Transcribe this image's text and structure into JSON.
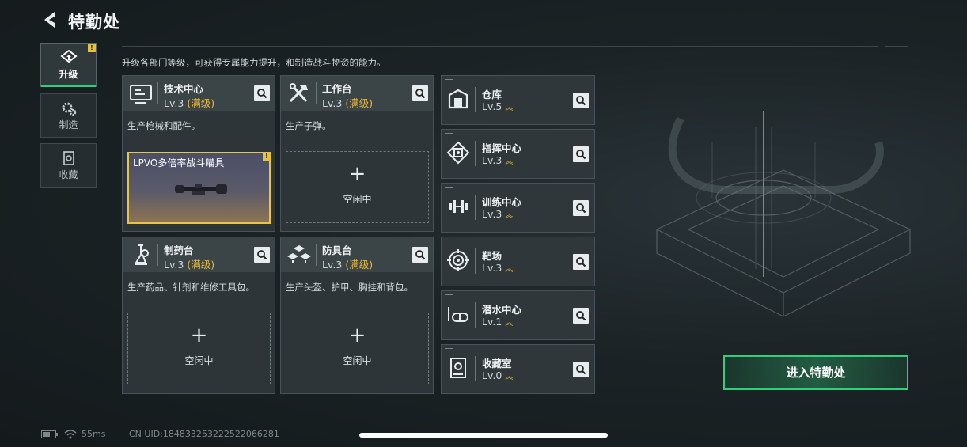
{
  "header": {
    "title": "特勤处",
    "description": "升级各部门等级，可获得专属能力提升，和制造战斗物资的能力。"
  },
  "sidebar": {
    "tabs": [
      {
        "label": "升级",
        "icon": "upgrade-icon",
        "active": true,
        "badge": "!"
      },
      {
        "label": "制造",
        "icon": "gears-icon",
        "active": false
      },
      {
        "label": "收藏",
        "icon": "collection-icon",
        "active": false
      }
    ]
  },
  "workshops": [
    {
      "name": "技术中心",
      "level": "Lv.3",
      "max": "(满级)",
      "desc": "生产枪械和配件。",
      "icon": "tech-center-icon",
      "slot": {
        "state": "producing",
        "item": "LPVO多倍率战斗瞄具",
        "badge": "!"
      }
    },
    {
      "name": "工作台",
      "level": "Lv.3",
      "max": "(满级)",
      "desc": "生产子弹。",
      "icon": "workbench-icon",
      "slot": {
        "state": "idle",
        "label": "空闲中"
      }
    },
    {
      "name": "制药台",
      "level": "Lv.3",
      "max": "(满级)",
      "desc": "生产药品、针剂和维修工具包。",
      "icon": "pharmacy-icon",
      "slot": {
        "state": "idle",
        "label": "空闲中"
      }
    },
    {
      "name": "防具台",
      "level": "Lv.3",
      "max": "(满级)",
      "desc": "生产头盔、护甲、胸挂和背包。",
      "icon": "armor-bench-icon",
      "slot": {
        "state": "idle",
        "label": "空闲中"
      }
    }
  ],
  "facilities": [
    {
      "name": "仓库",
      "level": "Lv.5",
      "icon": "warehouse-icon",
      "upgradable": true
    },
    {
      "name": "指挥中心",
      "level": "Lv.3",
      "icon": "command-center-icon",
      "upgradable": true
    },
    {
      "name": "训练中心",
      "level": "Lv.3",
      "icon": "training-center-icon",
      "upgradable": true
    },
    {
      "name": "靶场",
      "level": "Lv.3",
      "icon": "shooting-range-icon",
      "upgradable": true
    },
    {
      "name": "潜水中心",
      "level": "Lv.1",
      "icon": "diving-center-icon",
      "upgradable": true
    },
    {
      "name": "收藏室",
      "level": "Lv.0",
      "icon": "collection-room-icon",
      "upgradable": true
    }
  ],
  "enter_button": "进入特勤处",
  "status": {
    "ping": "55ms",
    "uid": "CN UID:1848332532225220662​81"
  },
  "colors": {
    "accent": "#2fd07a",
    "max_level": "#e7b93d",
    "badge": "#e8c23a"
  }
}
